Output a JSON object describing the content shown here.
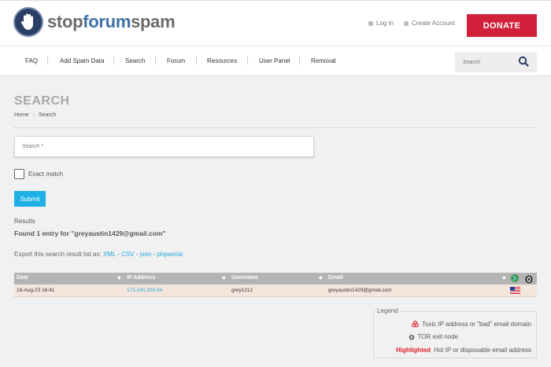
{
  "header": {
    "logo": {
      "part1": "stop",
      "part2": "forum",
      "part3": "spam"
    },
    "login_label": "Log in",
    "create_account_label": "Create Account",
    "donate_label": "DONATE"
  },
  "nav": {
    "items": [
      "FAQ",
      "Add Spam Data",
      "Search",
      "Forum",
      "Resources",
      "User Panel",
      "Removal"
    ],
    "search_placeholder": "Search"
  },
  "page": {
    "title": "SEARCH",
    "breadcrumb": [
      "Home",
      "Search"
    ]
  },
  "form": {
    "search_placeholder": "Search *",
    "exact_match_label": "Exact match",
    "exact_match_checked": false,
    "submit_label": "Submit"
  },
  "results": {
    "label": "Results",
    "found_text": "Found 1 entry for \"greyaustin1429@gmail.com\"",
    "export_prefix": "Export this search result list as:",
    "export_formats": [
      "XML",
      "CSV",
      "json",
      "phpserial"
    ],
    "export_separator": " - "
  },
  "table": {
    "headers": [
      "Date",
      "IP Address",
      "Username",
      "Email"
    ],
    "rows": [
      {
        "date": "16-Aug-23 16:41",
        "ip": "173.245.203.94",
        "username": "grey1212",
        "email": "greyaustin1429@gmail.com",
        "flag": "us-flag"
      }
    ]
  },
  "legend": {
    "title": "Legend",
    "items": [
      {
        "icon": "biohazard-icon",
        "text": "Toxic IP address or \"bad\" email domain"
      },
      {
        "icon": "tor-onion-icon",
        "text": "TOR exit node"
      },
      {
        "highlight": "Highlighted",
        "text": "Hot IP or disposable email address"
      }
    ]
  },
  "colors": {
    "donate": "#d0203a",
    "accent": "#1fb1e6",
    "row_highlight": "#f4e6dc",
    "table_header": "#b4b4b4"
  }
}
